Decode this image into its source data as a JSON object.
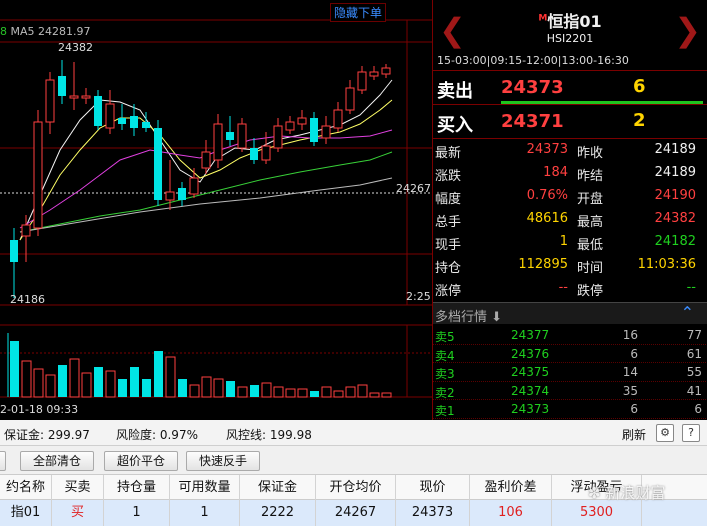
{
  "chart": {
    "hide_button": "隐藏下单",
    "ma_prefix": "8",
    "ma_label": "MA5 24281.97",
    "high_label": "24382",
    "low_label": "24186",
    "price_marker": "24267",
    "time_marker": "2:25",
    "date_label": "2-01-18 09:33"
  },
  "quote": {
    "title": "恒指01",
    "title_mark": "M",
    "code": "HSI2201",
    "session": "15-03:00|09:15-12:00|13:00-16:30",
    "sell_label": "卖出",
    "sell_price": "24373",
    "sell_volume": "6",
    "buy_label": "买入",
    "buy_price": "24371",
    "buy_volume": "2",
    "stats": [
      {
        "l1": "最新",
        "v1": "24373",
        "c1": "red",
        "l2": "昨收",
        "v2": "24189",
        "c2": "wht"
      },
      {
        "l1": "涨跌",
        "v1": "184",
        "c1": "red",
        "l2": "昨结",
        "v2": "24189",
        "c2": "wht"
      },
      {
        "l1": "幅度",
        "v1": "0.76%",
        "c1": "red",
        "l2": "开盘",
        "v2": "24190",
        "c2": "red"
      },
      {
        "l1": "总手",
        "v1": "48616",
        "c1": "yel",
        "l2": "最高",
        "v2": "24382",
        "c2": "red"
      },
      {
        "l1": "现手",
        "v1": "1",
        "c1": "yel",
        "l2": "最低",
        "v2": "24182",
        "c2": "grn"
      },
      {
        "l1": "持仓",
        "v1": "112895",
        "c1": "yel",
        "l2": "时间",
        "v2": "11:03:36",
        "c2": "yel"
      },
      {
        "l1": "涨停",
        "v1": "--",
        "c1": "red",
        "l2": "跌停",
        "v2": "--",
        "c2": "grn"
      }
    ],
    "depth_title": "多档行情",
    "depth": [
      {
        "name": "卖5",
        "price": "24377",
        "c": "16",
        "d": "77"
      },
      {
        "name": "卖4",
        "price": "24376",
        "c": "6",
        "d": "61"
      },
      {
        "name": "卖3",
        "price": "24375",
        "c": "14",
        "d": "55"
      },
      {
        "name": "卖2",
        "price": "24374",
        "c": "35",
        "d": "41"
      },
      {
        "name": "卖1",
        "price": "24373",
        "c": "6",
        "d": "6"
      }
    ]
  },
  "account": {
    "margin": "保证金: 299.97",
    "risk": "风险度: 0.97%",
    "risk_line": "风控线: 199.98",
    "refresh": "刷新"
  },
  "toolbar": {
    "close_all": "全部清仓",
    "super_close": "超价平仓",
    "quick_reverse": "快速反手"
  },
  "table": {
    "headers": [
      "约名称",
      "买卖",
      "持仓量",
      "可用数量",
      "保证金",
      "开仓均价",
      "现价",
      "盈利价差",
      "浮动盈亏"
    ],
    "row": [
      "指01",
      "买",
      "1",
      "1",
      "2222",
      "24267",
      "24373",
      "106",
      "5300"
    ]
  },
  "watermark": "新浪财富",
  "colors": {
    "up": "#ff4040",
    "down": "#00e5e5",
    "accent": "#3a8cff",
    "frame": "#7a0000"
  }
}
